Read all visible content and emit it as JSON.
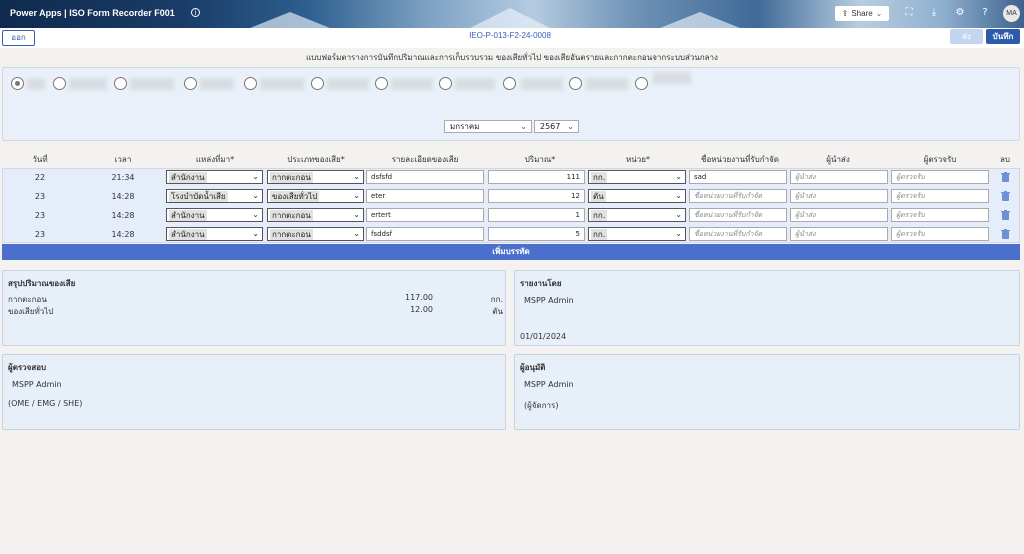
{
  "header": {
    "app_title": "Power Apps  |  ISO Form Recorder F001",
    "share_label": "Share",
    "avatar_initials": "MA"
  },
  "toolbar": {
    "logout_label": "ออก",
    "document_id": "IEO-P-013-F2-24-0008",
    "send_label": "ส่ง",
    "save_label": "บันทึก"
  },
  "form_title": "แบบฟอร์มตารางการบันทึกปริมาณและการเก็บรวบรวม ของเสียทั่วไป ของเสียอันตรายและกากตะกอนจากระบบส่วนกลาง",
  "filters": {
    "month_value": "มกราคม",
    "year_value": "2567"
  },
  "table": {
    "headers": [
      "วันที่",
      "เวลา",
      "แหล่งที่มา*",
      "ประเภทของเสีย*",
      "รายละเอียดของเสีย",
      "ปริมาณ*",
      "หน่วย*",
      "ชื่อหน่วยงานที่รับกำจัด",
      "ผู้นำส่ง",
      "ผู้ตรวจรับ",
      "ลบ"
    ],
    "rows": [
      {
        "day": "22",
        "time": "21:34",
        "source": "สำนักงาน",
        "type": "กากตะกอน",
        "detail": "dsfsfd",
        "qty": "111",
        "unit": "กก.",
        "agency": "sad",
        "agency_ph": false
      },
      {
        "day": "23",
        "time": "14:28",
        "source": "โรงบำบัดน้ำเสีย",
        "type": "ของเสียทั่วไป",
        "detail": "eter",
        "qty": "12",
        "unit": "ตัน",
        "agency": "ชื่อหน่วยงานที่รับกำจัด",
        "agency_ph": true
      },
      {
        "day": "23",
        "time": "14:28",
        "source": "สำนักงาน",
        "type": "กากตะกอน",
        "detail": "ertert",
        "qty": "1",
        "unit": "กก.",
        "agency": "ชื่อหน่วยงานที่รับกำจัด",
        "agency_ph": true
      },
      {
        "day": "23",
        "time": "14:28",
        "source": "สำนักงาน",
        "type": "กากตะกอน",
        "detail": "fsddsf",
        "qty": "5",
        "unit": "กก.",
        "agency": "ชื่อหน่วยงานที่รับกำจัด",
        "agency_ph": true
      }
    ],
    "sender_placeholder": "ผู้นำส่ง",
    "receiver_placeholder": "ผู้ตรวจรับ",
    "add_row_label": "เพิ่มบรรทัด"
  },
  "summary": {
    "title": "สรุปปริมาณของเสีย",
    "items": [
      {
        "label": "กากตะกอน",
        "value": "117.00",
        "unit": "กก."
      },
      {
        "label": "ของเสียทั่วไป",
        "value": "12.00",
        "unit": "ตัน"
      }
    ]
  },
  "reporter": {
    "title": "รายงานโดย",
    "name": "MSPP Admin",
    "date": "01/01/2024"
  },
  "inspector": {
    "title": "ผู้ตรวจสอบ",
    "name": "MSPP Admin",
    "dept": "(OME / EMG / SHE)"
  },
  "approver": {
    "title": "ผู้อนุมัติ",
    "name": "MSPP Admin",
    "role": "(ผู้จัดการ)"
  },
  "colors": {
    "primary": "#2e5aab",
    "add_row": "#4a6fcc",
    "panel_bg": "#e7eff9"
  },
  "icons": [
    "info-icon",
    "share-icon",
    "chevron-down-icon",
    "fit-screen-icon",
    "download-icon",
    "gear-icon",
    "help-icon",
    "trash-icon"
  ]
}
